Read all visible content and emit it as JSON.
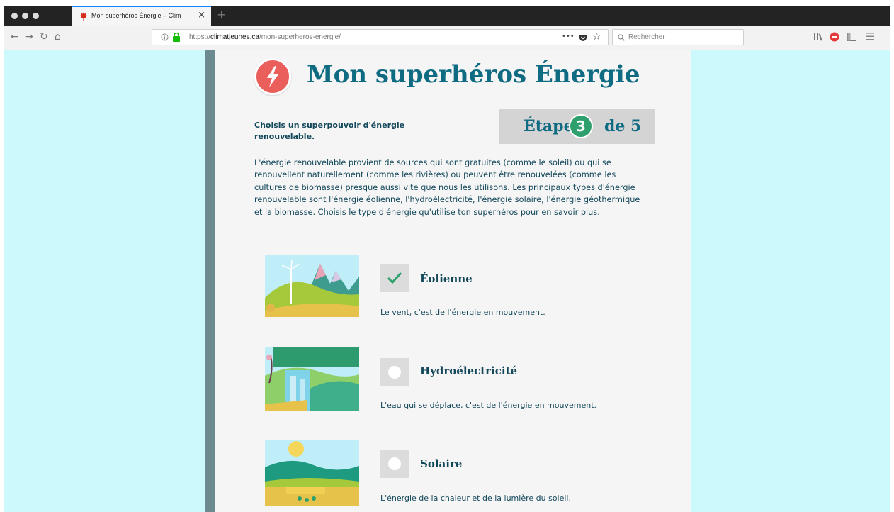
{
  "browser": {
    "tab_title": "Mon superhéros Énergie – Clim",
    "tab_close": "×",
    "new_tab": "+",
    "url_prefix": "https://",
    "url_domain": "climatjeunes.ca",
    "url_path": "/mon-superheros-energie/",
    "search_placeholder": "Rechercher",
    "more_label": "•••"
  },
  "page": {
    "title": "Mon superhéros Énergie",
    "subtitle": "Choisis un superpouvoir d'énergie renouvelable.",
    "step": {
      "word": "Étape",
      "current": "3",
      "total_label": "de 5"
    },
    "intro": "L'énergie renouvelable provient de sources qui sont gratuites (comme le soleil) ou qui se renouvellent naturellement (comme les rivières) ou peuvent être renouvelées (comme les cultures de biomasse) presque aussi vite que nous les utilisons. Les principaux types d'énergie renouvelable sont l'énergie éolienne, l'hydroélectricité, l'énergie solaire, l'énergie géothermique et la biomasse. Choisis le type d'énergie qu'utilise ton superhéros pour en savoir plus.",
    "options": [
      {
        "label": "Éolienne",
        "description": "Le vent, c'est de l'énergie en mouvement.",
        "checked": true
      },
      {
        "label": "Hydroélectricité",
        "description": "L'eau qui se déplace, c'est de l'énergie en mouvement.",
        "checked": false
      },
      {
        "label": "Solaire",
        "description": "L'énergie de la chaleur et de la lumière du soleil.",
        "checked": false
      }
    ]
  },
  "colors": {
    "accent": "#0e6b82",
    "background": "#ccf9fb",
    "step_badge": "#2ea06d",
    "logo": "#ea5f5b"
  }
}
